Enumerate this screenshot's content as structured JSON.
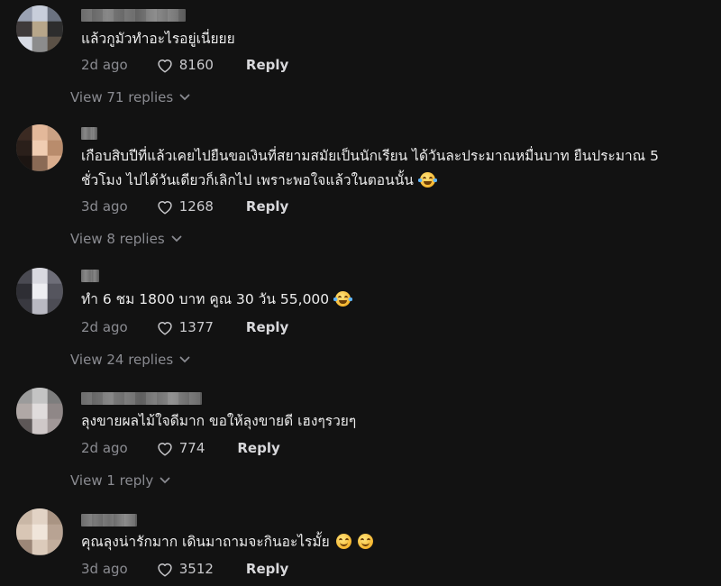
{
  "colors": {
    "background": "#121212",
    "text": "#ececec",
    "muted": "#8a8b91"
  },
  "comments": [
    {
      "text": "แล้วกูมัวทำอะไรอยู่เนี่ยยย",
      "time": "2d ago",
      "likes": "8160",
      "reply_label": "Reply",
      "view_replies": "View 71 replies",
      "avatar": [
        "#9aa2b3",
        "#c8cedb",
        "#6b7280",
        "#3f3a3a",
        "#b7a68a",
        "#2d2d2d",
        "#d7dbe4",
        "#8c8c8c",
        "#5b5146"
      ]
    },
    {
      "text": "เกือบสิบปีที่แล้วเคยไปยืนขอเงินที่สยามสมัยเป็นนักเรียน ได้วันละประมาณหมื่นบาท ยืนประมาณ 5 ชั่วโมง ไปได้วันเดียวก็เลิกไป เพราะพอใจแล้วในตอนนั้น",
      "emoji": "laugh",
      "time": "3d ago",
      "likes": "1268",
      "reply_label": "Reply",
      "view_replies": "View 8 replies",
      "avatar": [
        "#3b2a22",
        "#e3b89a",
        "#caa184",
        "#2a1f1a",
        "#f0cdb2",
        "#b98c6c",
        "#1c1512",
        "#8a6a55",
        "#d9ad8d"
      ]
    },
    {
      "text": "ทำ 6 ชม 1800 บาท คูณ 30 วัน 55,000",
      "emoji": "laugh",
      "time": "2d ago",
      "likes": "1377",
      "reply_label": "Reply",
      "view_replies": "View 24 replies",
      "avatar": [
        "#4a4a52",
        "#d9d9e0",
        "#6e6e78",
        "#2e2e34",
        "#eeeef2",
        "#55555e",
        "#393940",
        "#b9b9c2",
        "#4d4d55"
      ]
    },
    {
      "text": "ลุงขายผลไม้ใจดีมาก ขอให้ลุงขายดี เฮงๆรวยๆ",
      "time": "2d ago",
      "likes": "774",
      "reply_label": "Reply",
      "view_replies": "View 1 reply",
      "avatar": [
        "#9b9b9b",
        "#c4c4c4",
        "#7d7d7d",
        "#b0a8a6",
        "#e0dcdc",
        "#8f8787",
        "#5d5757",
        "#cfc8c8",
        "#a19898"
      ]
    },
    {
      "text": "คุณลุงน่ารักมาก เดินมาถามจะกินอะไรมั้ย",
      "emoji": "smile",
      "emoji2": "smile",
      "time": "3d ago",
      "likes": "3512",
      "reply_label": "Reply",
      "avatar": [
        "#c9b7a6",
        "#e2d3c5",
        "#a99483",
        "#d8c6b5",
        "#f0e5da",
        "#b8a393",
        "#9c8778",
        "#dccbbb",
        "#c2ae9d"
      ]
    }
  ]
}
